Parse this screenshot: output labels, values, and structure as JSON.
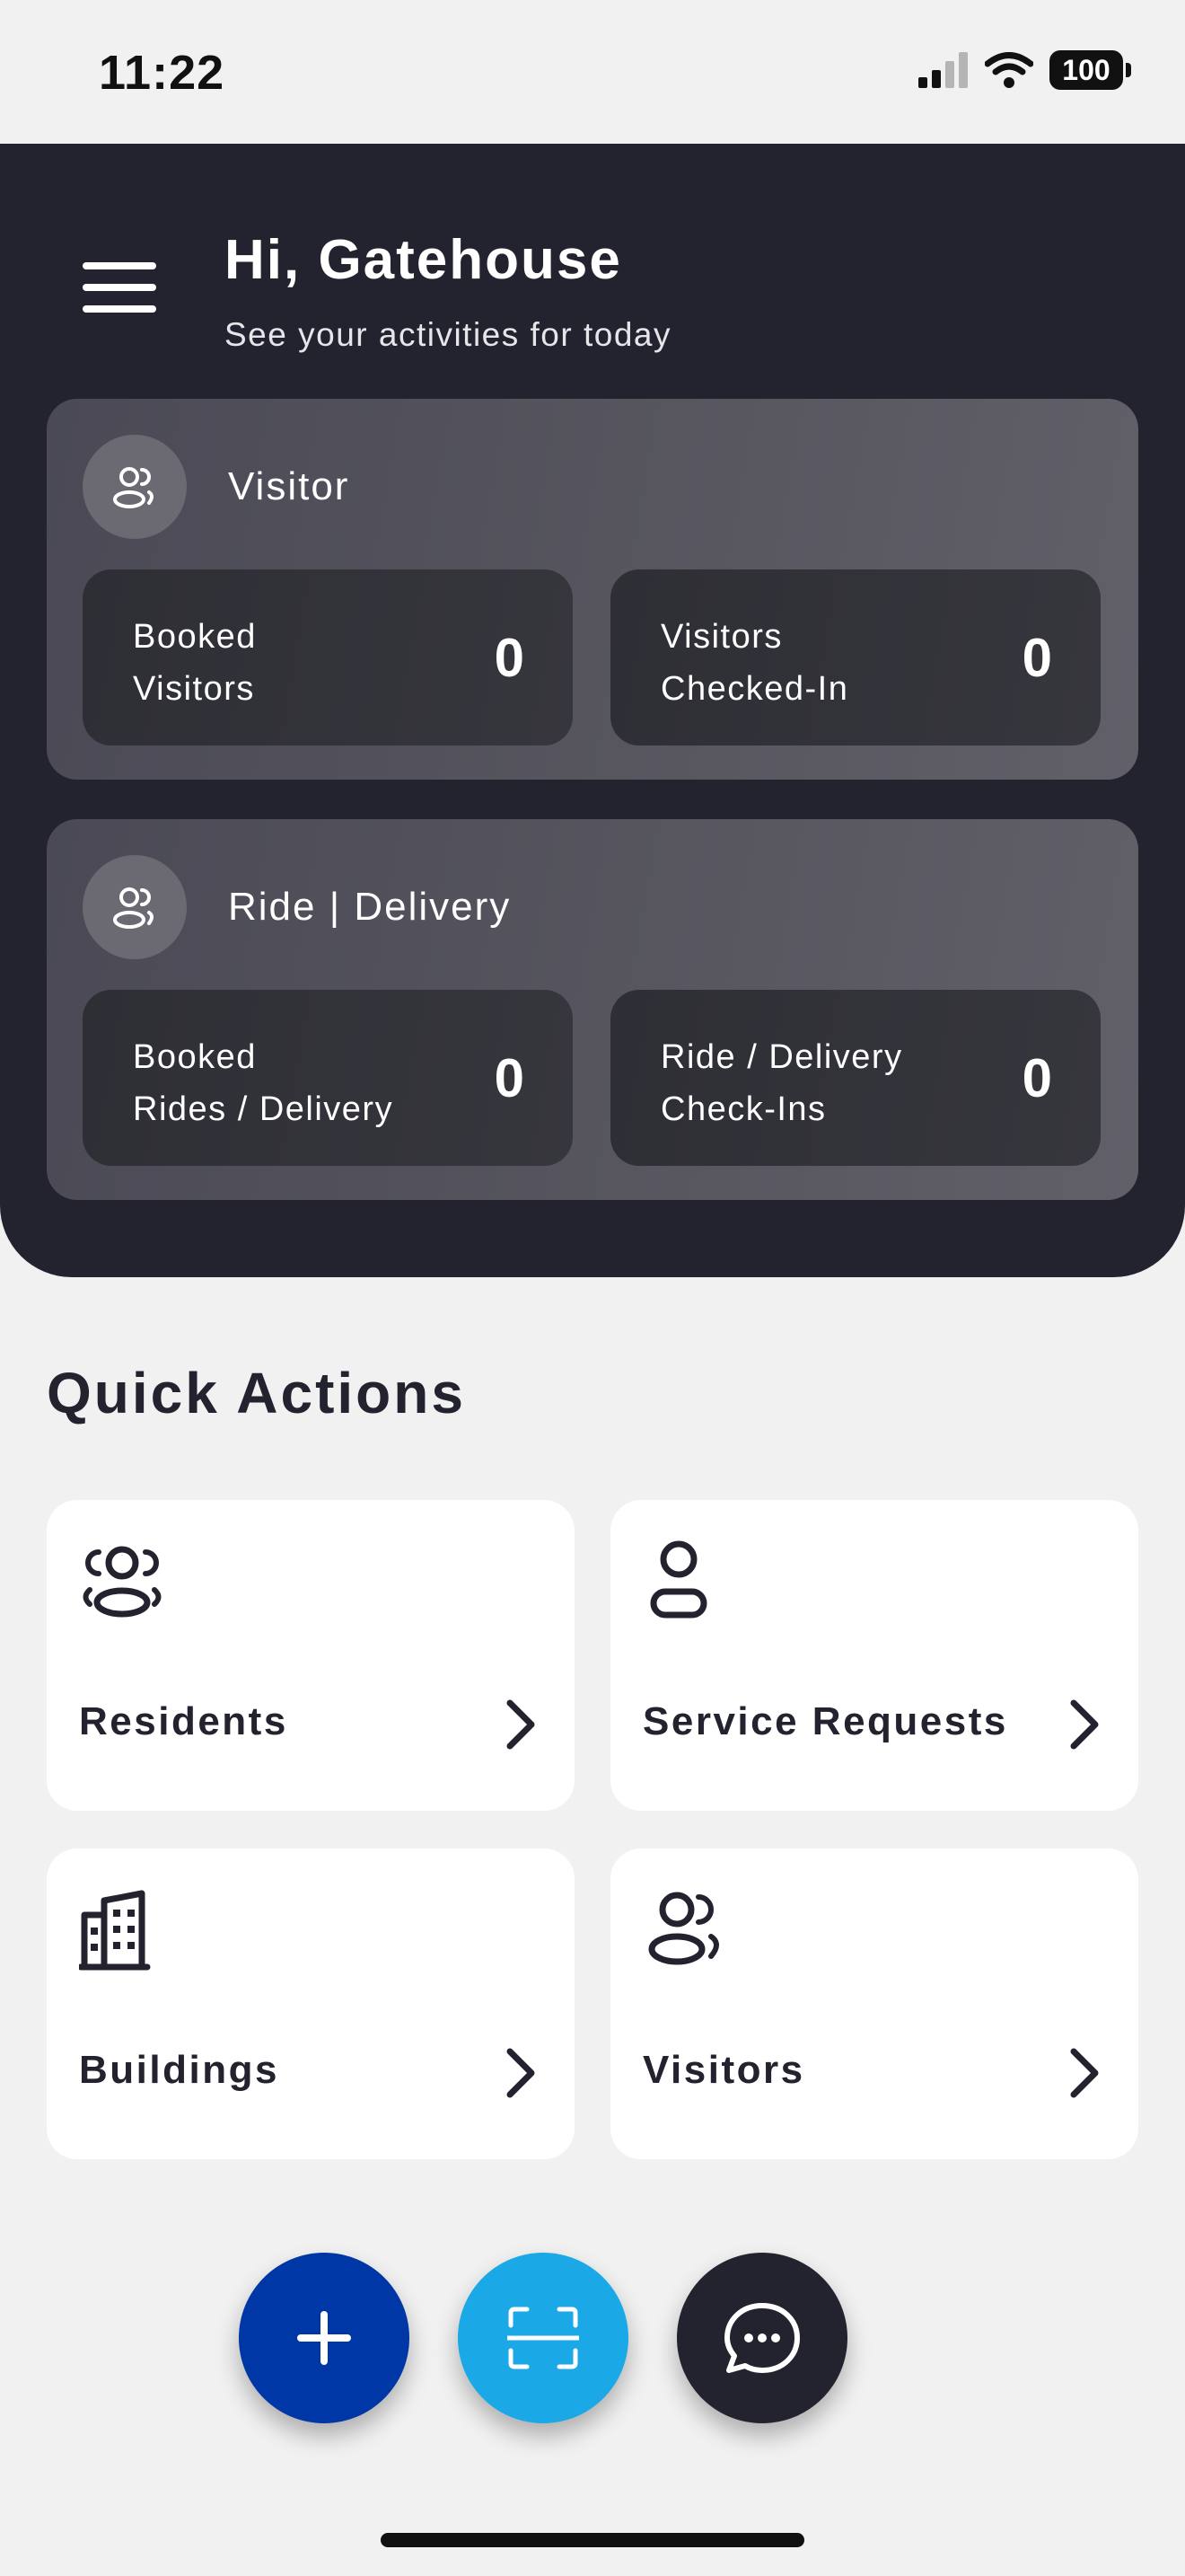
{
  "status_bar": {
    "time": "11:22",
    "battery": "100"
  },
  "header": {
    "greeting": "Hi, Gatehouse",
    "subtitle": "See your activities for today"
  },
  "cards": [
    {
      "title": "Visitor",
      "icon": "visitors-icon",
      "stats": [
        {
          "label": "Booked\nVisitors",
          "value": "0"
        },
        {
          "label": "Visitors\nChecked-In",
          "value": "0"
        }
      ]
    },
    {
      "title": "Ride | Delivery",
      "icon": "visitors-icon",
      "stats": [
        {
          "label": "Booked\nRides / Delivery",
          "value": "0"
        },
        {
          "label": "Ride / Delivery\nCheck-Ins",
          "value": "0"
        }
      ]
    }
  ],
  "quick_actions": {
    "title": "Quick Actions",
    "items": [
      {
        "label": "Residents",
        "icon": "residents-icon"
      },
      {
        "label": "Service Requests",
        "icon": "person-icon"
      },
      {
        "label": "Buildings",
        "icon": "building-icon"
      },
      {
        "label": "Visitors",
        "icon": "visitors-icon"
      }
    ]
  },
  "fabs": [
    {
      "name": "add",
      "icon": "plus-icon",
      "color": "#0037a6"
    },
    {
      "name": "scan",
      "icon": "scan-icon",
      "color": "#1aa9e6"
    },
    {
      "name": "chat",
      "icon": "chat-icon",
      "color": "#23232f"
    }
  ],
  "colors": {
    "header_bg": "#23232f",
    "page_bg": "#f1f1f1",
    "accent_blue": "#0037a6",
    "accent_cyan": "#1aa9e6"
  }
}
